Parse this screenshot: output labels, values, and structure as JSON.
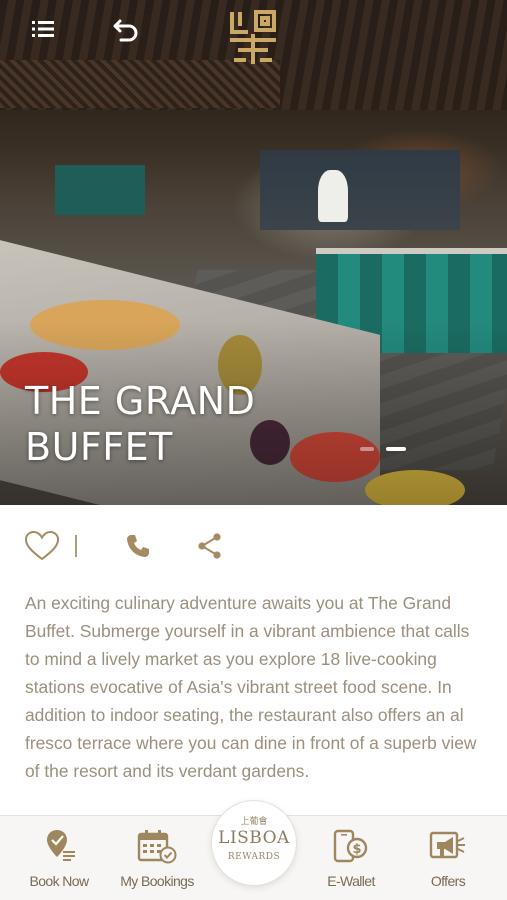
{
  "hero": {
    "title_line1": "THE GRAND",
    "title_line2": "BUFFET",
    "slides_total": 2,
    "slide_active": 2
  },
  "header": {
    "menu_icon": "hamburger-menu-icon",
    "back_icon": "undo-arrow-icon",
    "logo_icon": "restaurant-logo-icon"
  },
  "actions": {
    "favorite_icon": "heart-icon",
    "call_icon": "phone-icon",
    "share_icon": "share-icon"
  },
  "description": "An exciting culinary adventure awaits you at The Grand Buffet. Submerge yourself in a vibrant ambience that calls to mind a lively market as you explore 18 live-cooking stations evocative of Asia's vibrant street food scene. In addition to indoor seating, the restaurant also offers an al fresco terrace where you can dine in front of a superb view of the resort and its verdant gardens.",
  "bottom_nav": {
    "items": [
      {
        "label": "Book Now",
        "icon": "book-now-icon"
      },
      {
        "label": "My Bookings",
        "icon": "calendar-icon"
      },
      {
        "label": "E-Wallet",
        "icon": "wallet-phone-icon"
      },
      {
        "label": "Offers",
        "icon": "offers-megaphone-icon"
      }
    ],
    "rewards": {
      "chinese": "上葡會",
      "brand": "LISBOA",
      "sub": "REWARDS"
    }
  },
  "colors": {
    "accent": "#b59a72",
    "text": "#9c8f7e",
    "nav_label": "#7a6a55"
  }
}
